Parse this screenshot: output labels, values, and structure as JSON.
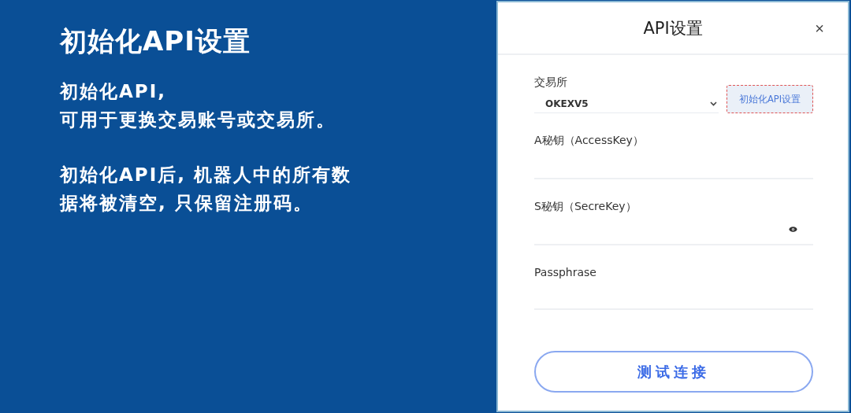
{
  "slide": {
    "title": "初始化API设置",
    "paragraphs": [
      [
        "初始化API,",
        "可用于更换交易账号或交易所。"
      ],
      [
        "初始化API后, 机器人中的所有数",
        "据将被清空, 只保留注册码。"
      ]
    ]
  },
  "dialog": {
    "title": "API设置",
    "close": "×",
    "exchange": {
      "label": "交易所",
      "value": "OKEXV5"
    },
    "reset_button": "初始化API设置",
    "fields": [
      {
        "label": "A秘钥（AccessKey）",
        "secret": false
      },
      {
        "label": "S秘钥（SecreKey）",
        "secret": true
      },
      {
        "label": "Passphrase",
        "secret": false
      }
    ],
    "test_button": "测试连接"
  }
}
